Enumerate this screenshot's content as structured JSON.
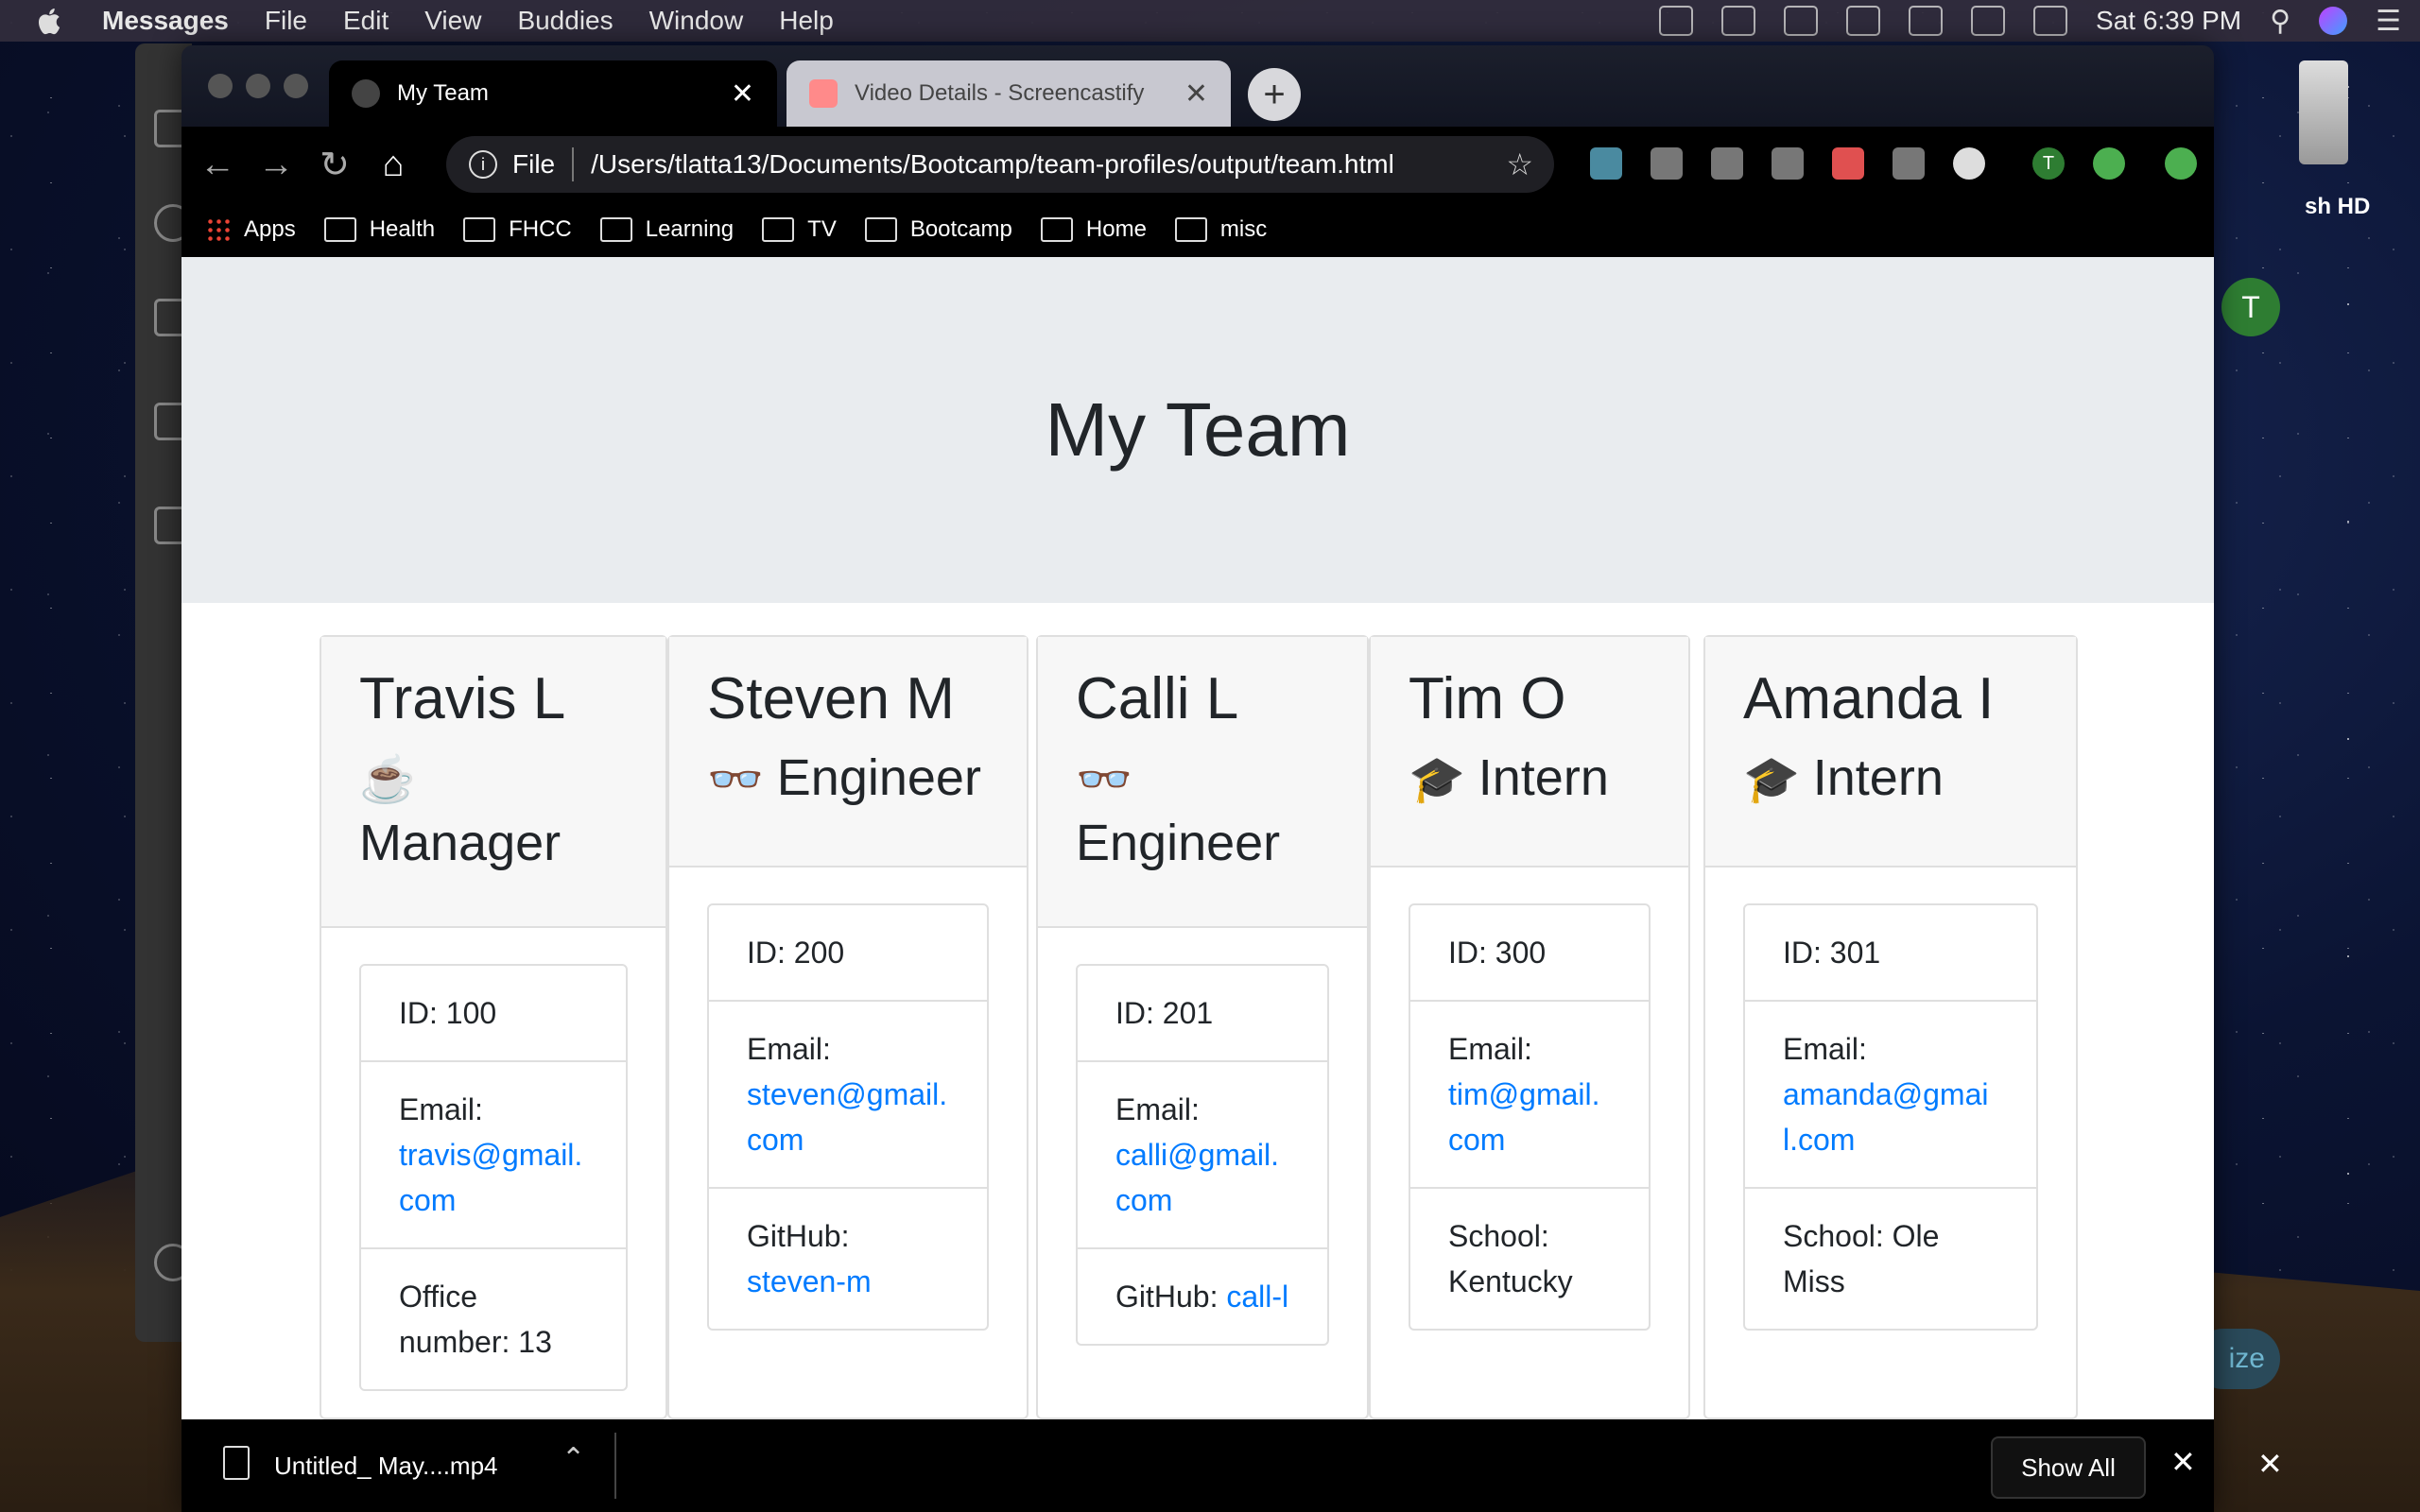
{
  "menubar": {
    "app": "Messages",
    "items": [
      "File",
      "Edit",
      "View",
      "Buddies",
      "Window",
      "Help"
    ],
    "clock": "Sat 6:39 PM"
  },
  "desktop": {
    "drive_label": "sh HD",
    "avatar_letter": "T",
    "pill_text": "ize"
  },
  "browser": {
    "tabs": [
      {
        "title": "My Team"
      },
      {
        "title": "Video Details - Screencastify"
      }
    ],
    "omnibox": {
      "scheme": "File",
      "url": "/Users/tlatta13/Documents/Bootcamp/team-profiles/output/team.html"
    },
    "profile_letter": "T",
    "bookmarks": [
      "Apps",
      "Health",
      "FHCC",
      "Learning",
      "TV",
      "Bootcamp",
      "Home",
      "misc"
    ]
  },
  "page": {
    "title": "My Team",
    "members": [
      {
        "name": "Travis L",
        "role": "Manager",
        "role_icon": "coffee-icon",
        "id_text": "ID: 100",
        "email_label": "Email:",
        "email": "travis@gmail.com",
        "extra_label": "Office number: 13",
        "extra_link": ""
      },
      {
        "name": "Steven M",
        "role": "Engineer",
        "role_icon": "glasses-icon",
        "id_text": "ID: 200",
        "email_label": "Email:",
        "email": "steven@gmail.com",
        "extra_label": "GitHub:",
        "extra_link": "steven-m"
      },
      {
        "name": "Calli L",
        "role": "Engineer",
        "role_icon": "glasses-icon",
        "id_text": "ID: 201",
        "email_label": "Email:",
        "email": "calli@gmail.com",
        "extra_label": "GitHub:",
        "extra_link": "call-l"
      },
      {
        "name": "Tim O",
        "role": "Intern",
        "role_icon": "graduate-icon",
        "id_text": "ID: 300",
        "email_label": "Email:",
        "email": "tim@gmail.com",
        "extra_label": "School: Kentucky",
        "extra_link": ""
      },
      {
        "name": "Amanda I",
        "role": "Intern",
        "role_icon": "graduate-icon",
        "id_text": "ID: 301",
        "email_label": "Email:",
        "email": "amanda@gmail.com",
        "extra_label": "School: Ole Miss",
        "extra_link": ""
      }
    ]
  },
  "download": {
    "filename": "Untitled_ May....mp4",
    "show_all": "Show All"
  },
  "colors": {
    "link": "#007bff",
    "jumbotron": "#e9ecef",
    "card_header": "#f7f7f7"
  }
}
